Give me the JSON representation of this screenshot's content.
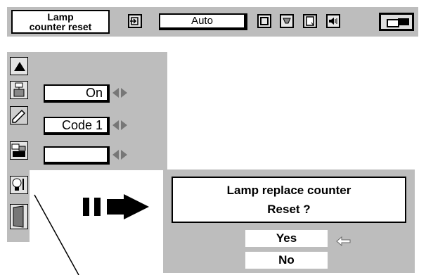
{
  "topbar": {
    "title_line1": "Lamp",
    "title_line2": "counter reset",
    "auto_label": "Auto",
    "icons": [
      "input-icon",
      "image-icon",
      "brightness-icon",
      "page-icon",
      "sound-icon",
      "screen-icon"
    ]
  },
  "left_menu": {
    "rows": [
      {
        "icon": "up-arrow-icon"
      },
      {
        "icon": "power-plug-icon",
        "value": "On"
      },
      {
        "icon": "pencil-icon",
        "value": "Code 1"
      },
      {
        "icon": "projector-icon",
        "value": ""
      },
      {
        "icon": "lamp-icon"
      },
      {
        "icon": "door-icon"
      }
    ]
  },
  "dialog": {
    "message_line1": "Lamp replace counter",
    "message_line2": "Reset ?",
    "yes_label": "Yes",
    "no_label": "No"
  },
  "colors": {
    "panel": "#bdbdbd",
    "field": "#ffffff",
    "border": "#000000"
  }
}
